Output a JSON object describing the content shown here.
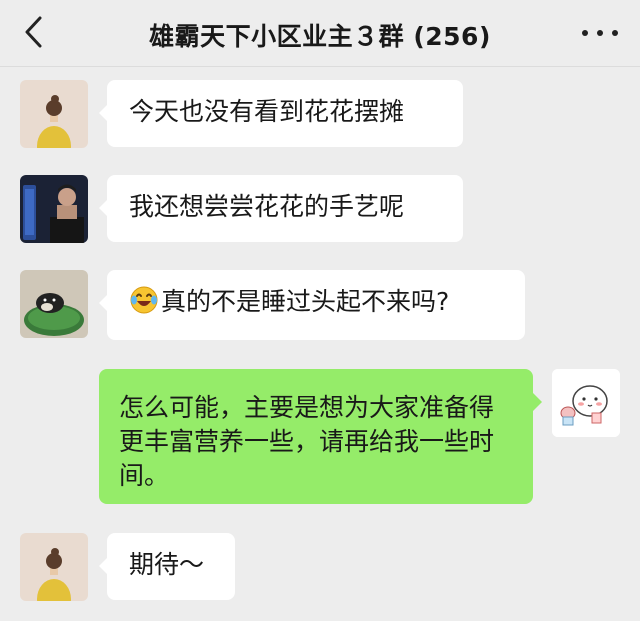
{
  "header": {
    "title": "雄霸天下小区业主３群 (256)",
    "back_icon": "chevron-left-icon",
    "more_icon": "more-dots-icon"
  },
  "colors": {
    "background": "#ededed",
    "incoming_bubble": "#ffffff",
    "outgoing_bubble": "#95ec69"
  },
  "messages": [
    {
      "side": "left",
      "avatar": "girl-avatar",
      "text": "今天也没有看到花花摆摊"
    },
    {
      "side": "left",
      "avatar": "man-avatar",
      "text": "我还想尝尝花花的手艺呢"
    },
    {
      "side": "left",
      "avatar": "dog-avatar",
      "emoji": "laughing-tears-emoji",
      "text": "真的不是睡过头起不来吗?"
    },
    {
      "side": "right",
      "avatar": "sticker-avatar",
      "text": "怎么可能，主要是想为大家准备得更丰富营养一些，请再给我一些时间。"
    },
    {
      "side": "left",
      "avatar": "girl-avatar",
      "text": "期待～"
    }
  ]
}
